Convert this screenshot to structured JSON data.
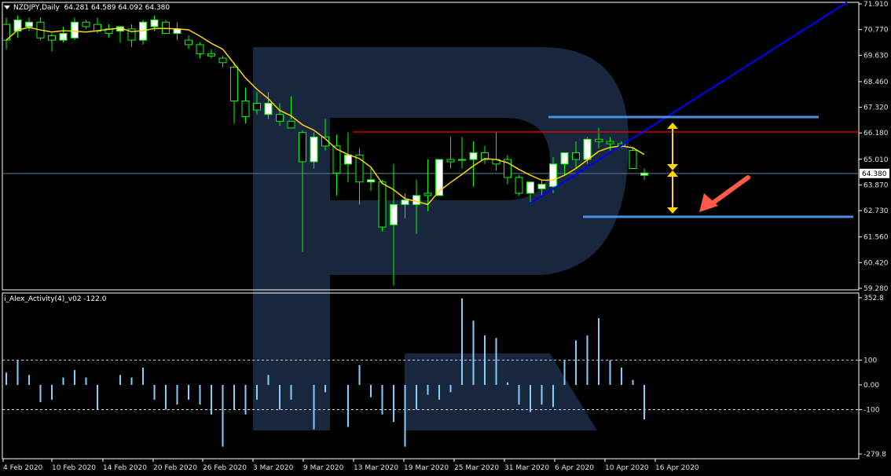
{
  "header": {
    "symbol_label": "NZDJPY,Daily",
    "ohlc": "64.281 64.589 64.092 64.380"
  },
  "indicator": {
    "label": "i_Alex_Activity(4)_v02 -122.0"
  },
  "colors": {
    "background": "#000000",
    "bull_candle": "#ffffff",
    "bear_candle": "#000000",
    "wick": "#00ff00",
    "ma_line": "#ffd700",
    "resistance_line": "#ff0000",
    "trend_line": "#0000ff",
    "channel_lines": "#4a90e2",
    "histogram": "#87cefa",
    "arrows": "#ffd700",
    "pointer_arrow": "#ff5a4a"
  },
  "chart_data": [
    {
      "type": "candlestick",
      "title": "NZDJPY,Daily",
      "y_ticks": [
        "71.910",
        "70.770",
        "69.630",
        "68.460",
        "67.320",
        "66.180",
        "65.010",
        "63.870",
        "62.730",
        "61.560",
        "60.420",
        "59.280"
      ],
      "y_range": [
        59.28,
        71.91
      ],
      "current_price_label": "64.380",
      "x_ticks": [
        "4 Feb 2020",
        "10 Feb 2020",
        "14 Feb 2020",
        "20 Feb 2020",
        "26 Feb 2020",
        "3 Mar 2020",
        "9 Mar 2020",
        "13 Mar 2020",
        "19 Mar 2020",
        "25 Mar 2020",
        "31 Mar 2020",
        "6 Apr 2020",
        "10 Apr 2020",
        "16 Apr 2020"
      ],
      "candles": [
        [
          71.0,
          71.3,
          69.9,
          70.3
        ],
        [
          70.7,
          71.4,
          70.4,
          71.2
        ],
        [
          70.9,
          71.3,
          70.7,
          71.1
        ],
        [
          71.1,
          71.3,
          70.3,
          70.4
        ],
        [
          70.5,
          70.6,
          69.8,
          70.3
        ],
        [
          70.3,
          70.9,
          70.2,
          70.6
        ],
        [
          70.4,
          71.3,
          70.3,
          71.1
        ],
        [
          71.1,
          71.2,
          70.8,
          70.9
        ],
        [
          71.0,
          71.3,
          70.6,
          70.7
        ],
        [
          70.8,
          71.0,
          70.4,
          70.6
        ],
        [
          70.7,
          70.8,
          70.2,
          70.9
        ],
        [
          70.8,
          71.0,
          70.0,
          70.3
        ],
        [
          70.3,
          71.2,
          70.1,
          71.1
        ],
        [
          70.9,
          71.4,
          70.7,
          71.2
        ],
        [
          71.1,
          71.2,
          70.6,
          70.6
        ],
        [
          70.6,
          71.1,
          70.3,
          70.8
        ],
        [
          70.3,
          70.5,
          69.9,
          70.1
        ],
        [
          70.1,
          70.2,
          69.5,
          69.7
        ],
        [
          69.7,
          69.9,
          69.5,
          69.6
        ],
        [
          69.5,
          69.6,
          69.1,
          69.3
        ],
        [
          69.1,
          69.3,
          66.6,
          67.6
        ],
        [
          67.6,
          68.2,
          66.6,
          66.9
        ],
        [
          67.5,
          68.0,
          67.0,
          67.2
        ],
        [
          67.0,
          68.0,
          66.8,
          67.5
        ],
        [
          67.0,
          67.5,
          66.5,
          66.7
        ],
        [
          66.7,
          67.8,
          66.8,
          66.4
        ],
        [
          66.2,
          66.3,
          60.9,
          64.9
        ],
        [
          64.9,
          66.2,
          64.6,
          66.0
        ],
        [
          66.0,
          66.8,
          65.4,
          65.6
        ],
        [
          65.6,
          66.1,
          63.4,
          64.4
        ],
        [
          64.8,
          66.2,
          64.0,
          65.2
        ],
        [
          65.2,
          65.5,
          63.0,
          64.0
        ],
        [
          64.0,
          64.6,
          63.6,
          64.1
        ],
        [
          64.0,
          64.1,
          61.8,
          62.0
        ],
        [
          62.1,
          64.8,
          59.4,
          63.0
        ],
        [
          63.0,
          63.5,
          62.4,
          63.2
        ],
        [
          63.0,
          64.1,
          61.7,
          63.4
        ],
        [
          63.5,
          65.0,
          62.7,
          63.4
        ],
        [
          63.4,
          65.0,
          63.4,
          65.0
        ],
        [
          65.0,
          66.0,
          64.6,
          64.9
        ],
        [
          65.0,
          66.0,
          64.6,
          65.0
        ],
        [
          65.0,
          65.8,
          63.8,
          65.3
        ],
        [
          65.3,
          65.6,
          64.8,
          65.0
        ],
        [
          65.0,
          66.2,
          64.5,
          64.8
        ],
        [
          65.0,
          65.2,
          63.9,
          64.2
        ],
        [
          64.2,
          64.3,
          63.4,
          63.5
        ],
        [
          63.5,
          64.0,
          63.0,
          64.0
        ],
        [
          63.7,
          64.1,
          63.4,
          63.9
        ],
        [
          63.8,
          65.1,
          63.5,
          64.8
        ],
        [
          64.8,
          65.2,
          64.3,
          65.3
        ],
        [
          65.3,
          65.8,
          64.6,
          65.0
        ],
        [
          65.0,
          66.0,
          64.8,
          65.9
        ],
        [
          65.9,
          66.4,
          65.5,
          65.8
        ],
        [
          65.8,
          66.0,
          65.4,
          65.7
        ],
        [
          65.7,
          65.8,
          65.5,
          65.6
        ],
        [
          65.4,
          65.5,
          64.6,
          64.6
        ],
        [
          64.3,
          64.6,
          64.1,
          64.4
        ]
      ],
      "indicator_series": {
        "name": "i_Alex_Activity(4)_v02",
        "y_ticks": [
          "352.8",
          "100",
          "0.00",
          "-100",
          "-279.8"
        ],
        "y_range": [
          -279.8,
          352.8
        ],
        "values": [
          50,
          100,
          40,
          -70,
          -60,
          30,
          60,
          30,
          -100,
          0,
          40,
          30,
          70,
          -60,
          -100,
          -80,
          -60,
          -80,
          -120,
          -250,
          -100,
          -120,
          -60,
          40,
          -100,
          -60,
          0,
          -180,
          -30,
          0,
          -170,
          80,
          -50,
          -120,
          -150,
          -250,
          -100,
          -40,
          -60,
          -30,
          350,
          260,
          200,
          190,
          10,
          -80,
          -110,
          -80,
          -90,
          100,
          180,
          200,
          270,
          100,
          70,
          20,
          -140
        ]
      }
    }
  ]
}
